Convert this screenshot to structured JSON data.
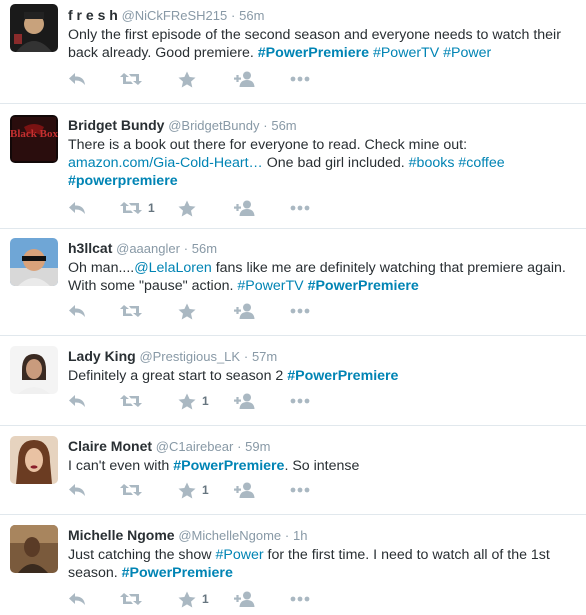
{
  "tweets": [
    {
      "fullname": "f r e s h",
      "username": "@NiCkFReSH215",
      "time": "56m",
      "text": [
        {
          "t": "Only the first episode of the second season and everyone needs to watch their back already. Good premiere. ",
          "s": "plain"
        },
        {
          "t": "#PowerPremiere",
          "s": "strong"
        },
        {
          "t": " ",
          "s": "plain"
        },
        {
          "t": "#PowerTV",
          "s": "link"
        },
        {
          "t": " ",
          "s": "plain"
        },
        {
          "t": "#Power",
          "s": "link"
        }
      ],
      "retweet_count": "",
      "favorite_count": ""
    },
    {
      "fullname": "Bridget Bundy",
      "username": "@BridgetBundy",
      "time": "56m",
      "text": [
        {
          "t": "There is a book out there for everyone to read. Check mine out: ",
          "s": "plain"
        },
        {
          "t": "amazon.com/Gia-Cold-Heart…",
          "s": "link"
        },
        {
          "t": " One bad girl included. ",
          "s": "plain"
        },
        {
          "t": "#books",
          "s": "link"
        },
        {
          "t": " ",
          "s": "plain"
        },
        {
          "t": "#coffee",
          "s": "link"
        },
        {
          "t": " ",
          "s": "plain"
        },
        {
          "t": "#powerpremiere",
          "s": "strong"
        }
      ],
      "avatar_text": "Black Box",
      "retweet_count": "1",
      "favorite_count": ""
    },
    {
      "fullname": "h3llcat",
      "username": "@aaangler",
      "time": "56m",
      "text": [
        {
          "t": "Oh man....",
          "s": "plain"
        },
        {
          "t": "@LelaLoren",
          "s": "link"
        },
        {
          "t": " fans like me are definitely watching that premiere again. With some \"pause\" action. ",
          "s": "plain"
        },
        {
          "t": "#PowerTV",
          "s": "link"
        },
        {
          "t": " ",
          "s": "plain"
        },
        {
          "t": "#PowerPremiere",
          "s": "strong"
        }
      ],
      "retweet_count": "",
      "favorite_count": ""
    },
    {
      "fullname": "Lady King",
      "username": "@Prestigious_LK",
      "time": "57m",
      "text": [
        {
          "t": "Definitely a great start to season 2 ",
          "s": "plain"
        },
        {
          "t": "#PowerPremiere",
          "s": "strong"
        }
      ],
      "retweet_count": "",
      "favorite_count": "1"
    },
    {
      "fullname": "Claire Monet",
      "username": "@C1airebear",
      "time": "59m",
      "text": [
        {
          "t": "I can't even with ",
          "s": "plain"
        },
        {
          "t": "#PowerPremiere",
          "s": "strong"
        },
        {
          "t": ". So intense",
          "s": "plain"
        }
      ],
      "retweet_count": "",
      "favorite_count": "1"
    },
    {
      "fullname": "Michelle Ngome",
      "username": "@MichelleNgome",
      "time": "1h",
      "text": [
        {
          "t": "Just catching the show ",
          "s": "plain"
        },
        {
          "t": "#Power",
          "s": "link"
        },
        {
          "t": " for the first time. I need to watch all of the 1st season. ",
          "s": "plain"
        },
        {
          "t": "#PowerPremiere",
          "s": "strong"
        }
      ],
      "retweet_count": "",
      "favorite_count": "1"
    }
  ],
  "icons": {
    "reply": "reply-icon",
    "retweet": "retweet-icon",
    "favorite": "star-icon",
    "follow": "follow-icon",
    "more": "more-icon"
  },
  "colors": {
    "link": "#0084b4",
    "icon": "#aab8c2",
    "meta": "#8899a6",
    "divider": "#e1e8ed"
  }
}
